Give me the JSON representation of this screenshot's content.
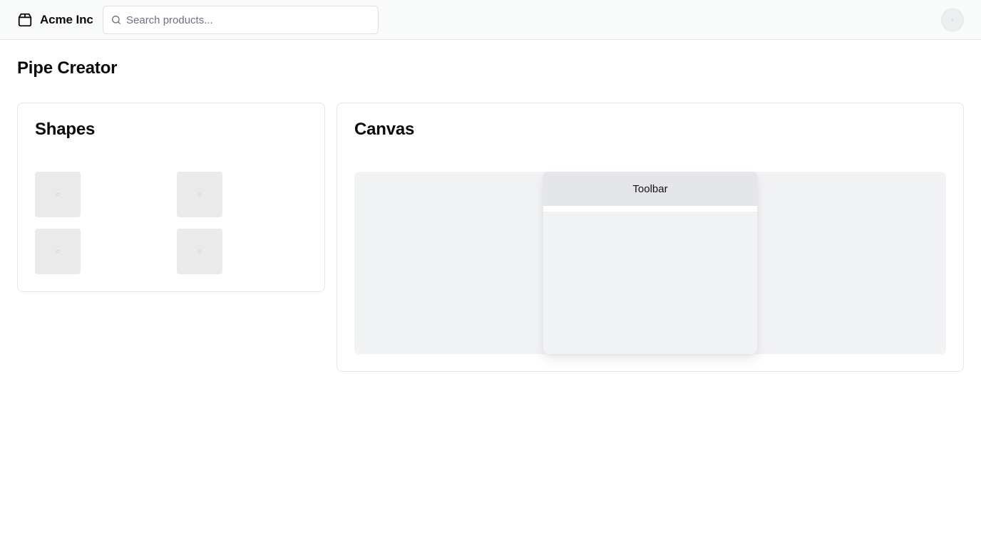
{
  "header": {
    "brand_name": "Acme Inc",
    "brand_icon": "package-icon",
    "search": {
      "placeholder": "Search products...",
      "value": "",
      "icon": "search-icon"
    }
  },
  "page": {
    "title": "Pipe Creator"
  },
  "shapes_panel": {
    "title": "Shapes",
    "items": [
      "shape-1",
      "shape-2",
      "shape-3",
      "shape-4"
    ]
  },
  "canvas_panel": {
    "title": "Canvas",
    "toolbar": {
      "label": "Toolbar"
    }
  },
  "colors": {
    "header_bg": "#f9fafa",
    "border": "#e4e6e8",
    "canvas_bg": "#f2f3f5",
    "toolbar_header_bg": "#e5e6e9",
    "shape_tile_bg": "#eaeaea"
  }
}
